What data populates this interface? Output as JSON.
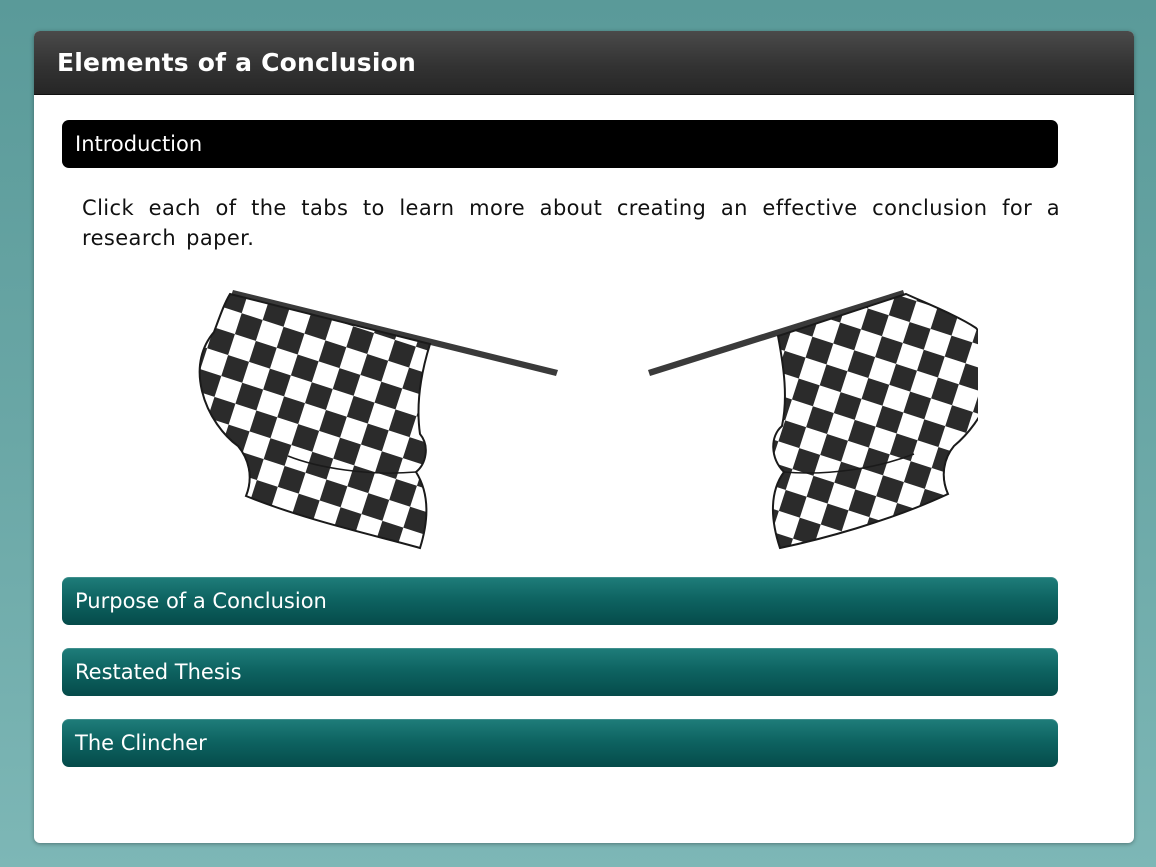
{
  "window": {
    "title": "Elements of a Conclusion"
  },
  "tabs": {
    "active_label": "Introduction",
    "items": [
      {
        "label": "Purpose of a Conclusion"
      },
      {
        "label": "Restated Thesis"
      },
      {
        "label": "The Clincher"
      }
    ]
  },
  "content": {
    "intro_text": "Click each of the tabs to learn more about creating an effective conclusion for a research paper.",
    "illustration": "checkered-flags-icon"
  },
  "colors": {
    "background": "#6aa7a6",
    "titlebar": "#333333",
    "active_tab": "#000000",
    "tab": "#0e6462"
  }
}
